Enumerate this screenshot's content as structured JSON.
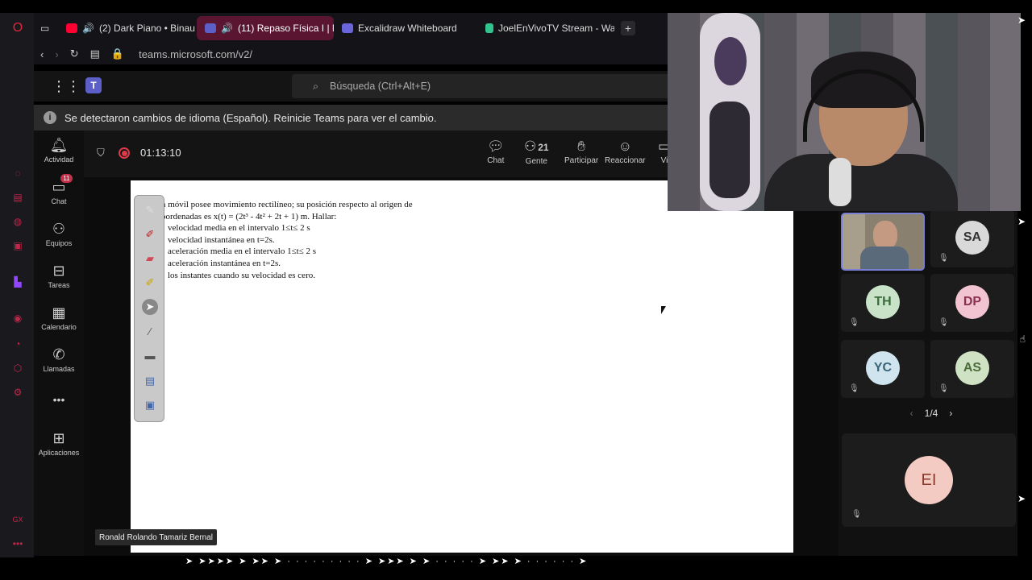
{
  "browser": {
    "tabs": [
      {
        "label": "(2) Dark Piano • Binau",
        "icon": "youtube-icon",
        "color": "#ff0033"
      },
      {
        "label": "(11) Repaso Física I | M",
        "icon": "teams-icon",
        "color": "#5b5fc7",
        "active": true
      },
      {
        "label": "Excalidraw Whiteboard",
        "icon": "excalidraw-icon",
        "color": "#6965db"
      },
      {
        "label": "JoelEnVivoTV Stream - Wa",
        "icon": "streamlabs-icon",
        "color": "#31c48d"
      }
    ],
    "new_tab": "+",
    "url": "teams.microsoft.com/v2/"
  },
  "teams": {
    "search_placeholder": "Búsqueda (Ctrl+Alt+E)",
    "notice": "Se detectaron cambios de idioma (Español). Reinicie Teams para ver el cambio.",
    "nav": [
      {
        "label": "Actividad",
        "icon": "bell-icon"
      },
      {
        "label": "Chat",
        "icon": "chat-icon",
        "badge": "11"
      },
      {
        "label": "Equipos",
        "icon": "teams-people-icon"
      },
      {
        "label": "Tareas",
        "icon": "backpack-icon"
      },
      {
        "label": "Calendario",
        "icon": "calendar-icon"
      },
      {
        "label": "Llamadas",
        "icon": "phone-icon"
      },
      {
        "label": "•••",
        "icon": "more-icon"
      },
      {
        "label": "Aplicaciones",
        "icon": "plus-square-icon"
      }
    ],
    "meeting": {
      "timer": "01:13:10",
      "tools": [
        {
          "label": "Chat",
          "icon": "chat-bubble-icon"
        },
        {
          "label": "Gente",
          "icon": "people-icon",
          "count": "21"
        },
        {
          "label": "Participar",
          "icon": "raise-hand-icon"
        },
        {
          "label": "Reaccionar",
          "icon": "smile-icon"
        },
        {
          "label": "Vi",
          "icon": "view-icon"
        }
      ]
    },
    "document": {
      "lines": [
        "n  móvil  posee  movimiento  rectilíneo;  su  posición  respecto  al  origen  de",
        "oordenadas es x(t) = (2t³  - 4t²  + 2t  + 1) m. Hallar:",
        "velocidad media en el intervalo   1≤t≤ 2   s",
        "velocidad instantánea en t=2s.",
        "aceleración media en el intervalo   1≤t≤ 2   s",
        "aceleración instantánea en t=2s.",
        "los instantes cuando su velocidad es cero."
      ]
    },
    "presenter_name": "Ronald Rolando Tamariz Bernal",
    "participants": [
      {
        "initials": "SA",
        "bg": "#d9d9d9",
        "fg": "#333"
      },
      {
        "initials": "TH",
        "bg": "#c8e3c8",
        "fg": "#3b6b3b"
      },
      {
        "initials": "DP",
        "bg": "#f2c4d2",
        "fg": "#8a3050"
      },
      {
        "initials": "YC",
        "bg": "#cfe4ee",
        "fg": "#3a6577"
      },
      {
        "initials": "AS",
        "bg": "#cfe3c4",
        "fg": "#4a6b3a"
      }
    ],
    "pager": "1/4",
    "big_participant": {
      "initials": "EI",
      "bg": "#f4cbc2",
      "fg": "#8a3a2a"
    }
  }
}
